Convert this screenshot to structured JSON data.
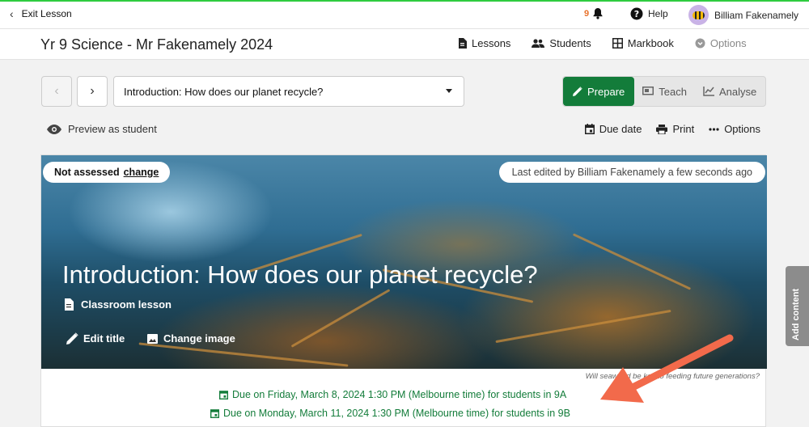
{
  "topbar": {
    "exit_label": "Exit Lesson",
    "notification_count": "9",
    "help_label": "Help",
    "user_name": "Billiam Fakenamely"
  },
  "classbar": {
    "title": "Yr 9 Science - Mr Fakenamely 2024",
    "nav": [
      "Lessons",
      "Students",
      "Markbook",
      "Options"
    ]
  },
  "lesson_select": {
    "value": "Introduction: How does our planet recycle?"
  },
  "modes": {
    "prepare": "Prepare",
    "teach": "Teach",
    "analyse": "Analyse",
    "active": "Prepare"
  },
  "actions": {
    "preview": "Preview as student",
    "due_date": "Due date",
    "print": "Print",
    "options": "Options"
  },
  "hero": {
    "assessment_status": "Not assessed",
    "assessment_link": "change",
    "last_edited": "Last edited by Billiam Fakenamely a few seconds ago",
    "title": "Introduction: How does our planet recycle?",
    "lesson_type": "Classroom lesson",
    "edit_title": "Edit title",
    "change_image": "Change image"
  },
  "caption": "Will seaweed be key to feeding future generations?",
  "due_dates": [
    "Due on Friday, March 8, 2024 1:30 PM (Melbourne time) for students in 9A",
    "Due on Monday, March 11, 2024 1:30 PM (Melbourne time) for students in 9B"
  ],
  "side_tab": "Add content",
  "colors": {
    "accent_green": "#137c3a",
    "top_border": "#2ecc40",
    "notification": "#e8722c",
    "annotation_arrow": "#f26a4b"
  }
}
